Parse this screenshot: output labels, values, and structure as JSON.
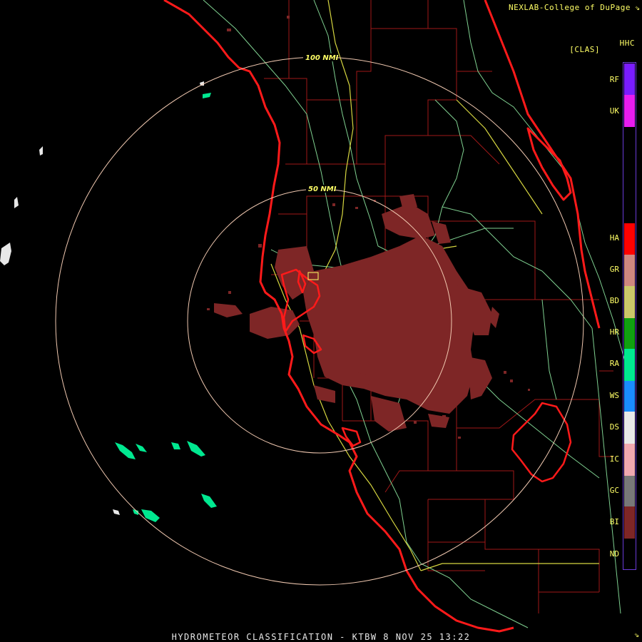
{
  "header": {
    "credit": "NEXLAB-College of DuPage",
    "product": "HHC",
    "class_code": "[CLAS]"
  },
  "footer": {
    "caption": "HYDROMETEOR CLASSIFICATION - KTBW 8 NOV 25 13:22"
  },
  "range_rings": {
    "inner_label": "50 NMI",
    "outer_label": "100 NMI"
  },
  "legend": [
    {
      "code": "RF",
      "color": "#7a1cff"
    },
    {
      "code": "UK",
      "color": "#e81cf0"
    },
    {
      "code": "",
      "color": "#000000"
    },
    {
      "code": "HA",
      "color": "#ff0000"
    },
    {
      "code": "GR",
      "color": "#cf8780"
    },
    {
      "code": "BD",
      "color": "#cbc76a"
    },
    {
      "code": "HR",
      "color": "#10a010"
    },
    {
      "code": "RA",
      "color": "#00e890"
    },
    {
      "code": "WS",
      "color": "#1a8cff"
    },
    {
      "code": "DS",
      "color": "#e8e8e8"
    },
    {
      "code": "IC",
      "color": "#f0a8b0"
    },
    {
      "code": "GC",
      "color": "#787878"
    },
    {
      "code": "BI",
      "color": "#7e2626"
    },
    {
      "code": "ND",
      "color": "#000000"
    }
  ],
  "colors": {
    "coast": "#ff1a1a",
    "county": "#a01818",
    "highway_major": "#d6d640",
    "highway_minor": "#7fd090",
    "ring": "#f0c8b0",
    "echo": "#7e2626",
    "rain": "#00e890",
    "dry_snow": "#e8e8e8"
  }
}
